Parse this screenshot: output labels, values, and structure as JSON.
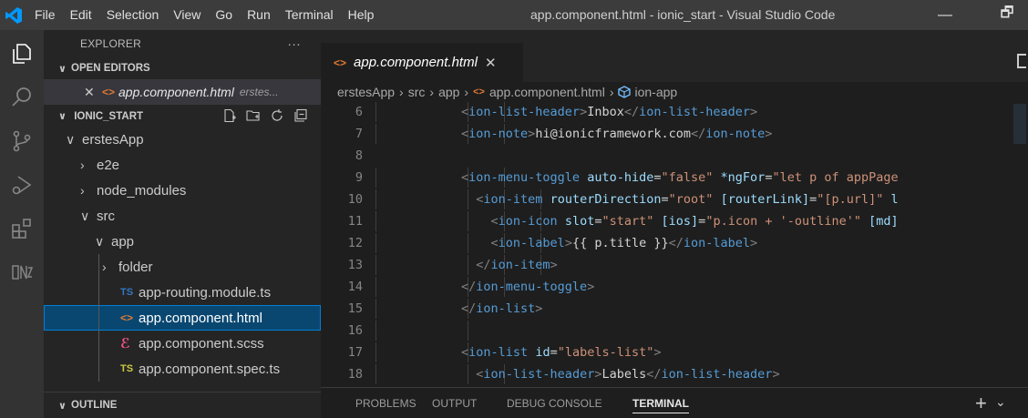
{
  "window": {
    "title": "app.component.html - ionic_start - Visual Studio Code",
    "menu": [
      "File",
      "Edit",
      "Selection",
      "View",
      "Go",
      "Run",
      "Terminal",
      "Help"
    ],
    "minimize": "—",
    "restore": "🗗"
  },
  "sidebar": {
    "title": "EXPLORER",
    "more": "···",
    "open_editors": {
      "label": "OPEN EDITORS",
      "file": "app.component.html",
      "folder": "erstes..."
    },
    "workspace": {
      "label": "IONIC_START",
      "tree": [
        {
          "label": "erstesApp"
        },
        {
          "label": "e2e"
        },
        {
          "label": "node_modules"
        },
        {
          "label": "src"
        },
        {
          "label": "app"
        },
        {
          "label": "folder"
        },
        {
          "label": "app-routing.module.ts",
          "badge": "TS"
        },
        {
          "label": "app.component.html",
          "badge": "<>"
        },
        {
          "label": "app.component.scss",
          "badge": "ℰ"
        },
        {
          "label": "app.component.spec.ts",
          "badge": "TS"
        }
      ]
    },
    "outline": {
      "label": "OUTLINE"
    }
  },
  "editor": {
    "tab": {
      "label": "app.component.html",
      "close": "✕"
    },
    "breadcrumb": [
      "erstesApp",
      "src",
      "app",
      "app.component.html",
      "ion-app"
    ],
    "lines": [
      {
        "n": "6",
        "html": "<span class=\"p\">&lt;</span><span class=\"t\">ion-list-header</span><span class=\"p\">&gt;</span><span class=\"x\">Inbox</span><span class=\"p\">&lt;/</span><span class=\"t\">ion-list-header</span><span class=\"p\">&gt;</span>"
      },
      {
        "n": "7",
        "html": "<span class=\"p\">&lt;</span><span class=\"t\">ion-note</span><span class=\"p\">&gt;</span><span class=\"x\">hi@ionicframework.com</span><span class=\"p\">&lt;/</span><span class=\"t\">ion-note</span><span class=\"p\">&gt;</span>"
      },
      {
        "n": "8",
        "html": ""
      },
      {
        "n": "9",
        "html": "<span class=\"p\">&lt;</span><span class=\"t\">ion-menu-toggle</span> <span class=\"a\">auto-hide</span><span class=\"x\">=</span><span class=\"s\">\"false\"</span> <span class=\"a\">*ngFor</span><span class=\"x\">=</span><span class=\"s\">\"let p of appPage</span>"
      },
      {
        "n": "10",
        "html": "  <span class=\"p\">&lt;</span><span class=\"t\">ion-item</span> <span class=\"a\">routerDirection</span><span class=\"x\">=</span><span class=\"s\">\"root\"</span> <span class=\"a\">[routerLink]</span><span class=\"x\">=</span><span class=\"s\">\"[p.url]\"</span> <span class=\"a\">l</span>"
      },
      {
        "n": "11",
        "html": "    <span class=\"p\">&lt;</span><span class=\"t\">ion-icon</span> <span class=\"a\">slot</span><span class=\"x\">=</span><span class=\"s\">\"start\"</span> <span class=\"a\">[ios]</span><span class=\"x\">=</span><span class=\"s\">\"p.icon + '-outline'\"</span> <span class=\"a\">[md]</span>"
      },
      {
        "n": "12",
        "html": "    <span class=\"p\">&lt;</span><span class=\"t\">ion-label</span><span class=\"p\">&gt;</span><span class=\"x\">{{ p.title }}</span><span class=\"p\">&lt;/</span><span class=\"t\">ion-label</span><span class=\"p\">&gt;</span>"
      },
      {
        "n": "13",
        "html": "  <span class=\"p\">&lt;/</span><span class=\"t\">ion-item</span><span class=\"p\">&gt;</span>"
      },
      {
        "n": "14",
        "html": "<span class=\"p\">&lt;/</span><span class=\"t\">ion-menu-toggle</span><span class=\"p\">&gt;</span>"
      },
      {
        "n": "15",
        "html": "<span class=\"p\">&lt;/</span><span class=\"t\">ion-list</span><span class=\"p\">&gt;</span>"
      },
      {
        "n": "16",
        "html": ""
      },
      {
        "n": "17",
        "html": "<span class=\"p\">&lt;</span><span class=\"t\">ion-list</span> <span class=\"a\">id</span><span class=\"x\">=</span><span class=\"s\">\"labels-list\"</span><span class=\"p\">&gt;</span>"
      },
      {
        "n": "18",
        "html": "  <span class=\"p\">&lt;</span><span class=\"t\">ion-list-header</span><span class=\"p\">&gt;</span><span class=\"x\">Labels</span><span class=\"p\">&lt;/</span><span class=\"t\">ion-list-header</span><span class=\"p\">&gt;</span>"
      }
    ]
  },
  "panel": {
    "tabs": [
      "PROBLEMS",
      "OUTPUT",
      "DEBUG CONSOLE",
      "TERMINAL"
    ],
    "active": "TERMINAL",
    "add": "+",
    "chevron": "⌄"
  },
  "colors": {
    "accent": "#007fd4",
    "selection": "#094771",
    "tag": "#569cd6",
    "attribute": "#9cdcfe",
    "string": "#ce9178"
  }
}
